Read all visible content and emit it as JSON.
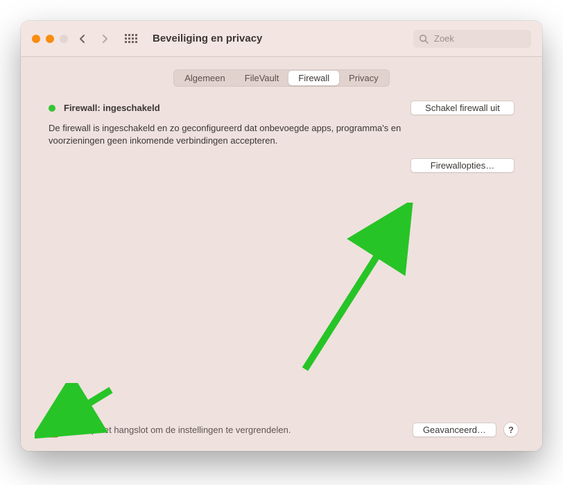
{
  "header": {
    "title": "Beveiliging en privacy",
    "search_placeholder": "Zoek"
  },
  "tabs": {
    "items": [
      "Algemeen",
      "FileVault",
      "Firewall",
      "Privacy"
    ],
    "selected_index": 2
  },
  "status": {
    "color": "#33c533",
    "label": "Firewall: ingeschakeld",
    "disable_button": "Schakel firewall uit"
  },
  "description": "De firewall is ingeschakeld en zo geconfigureerd dat onbevoegde apps, programma's en voorzieningen geen inkomende verbindingen accepteren.",
  "options_button": "Firewallopties…",
  "footer": {
    "lock_text": "Klik op het hangslot om de instellingen te vergrendelen.",
    "advanced_button": "Geavanceerd…",
    "help_label": "?"
  }
}
